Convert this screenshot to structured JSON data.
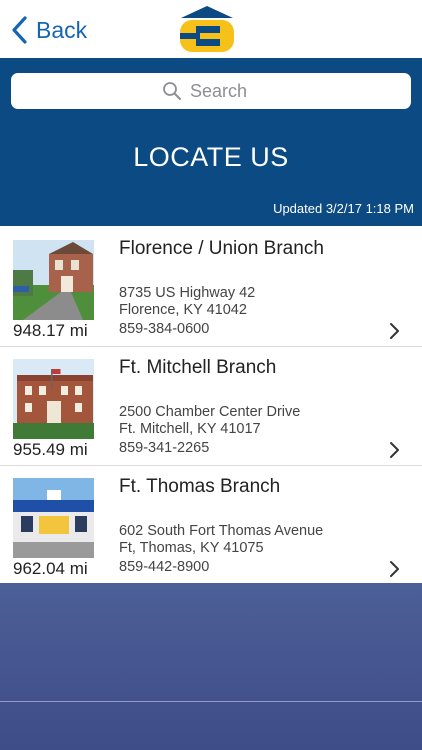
{
  "nav": {
    "back_label": "Back"
  },
  "header": {
    "search_placeholder": "Search",
    "title": "LOCATE US",
    "updated": "Updated 3/2/17 1:18 PM"
  },
  "branches": [
    {
      "distance": "948.17 mi",
      "name": "Florence / Union Branch",
      "address_line1": "8735 US Highway 42",
      "address_line2": "Florence, KY 41042",
      "phone": "859-384-0600"
    },
    {
      "distance": "955.49 mi",
      "name": "Ft. Mitchell Branch",
      "address_line1": "2500 Chamber Center Drive",
      "address_line2": "Ft. Mitchell, KY 41017",
      "phone": "859-341-2265"
    },
    {
      "distance": "962.04 mi",
      "name": "Ft. Thomas Branch",
      "address_line1": "602 South Fort Thomas Avenue",
      "address_line2": "Ft, Thomas, KY 41075",
      "phone": "859-442-8900"
    }
  ],
  "colors": {
    "header_bg": "#0b4a82",
    "accent": "#1565b5",
    "logo_yellow": "#f6c21a",
    "footer_bg": "#4a5b94"
  }
}
